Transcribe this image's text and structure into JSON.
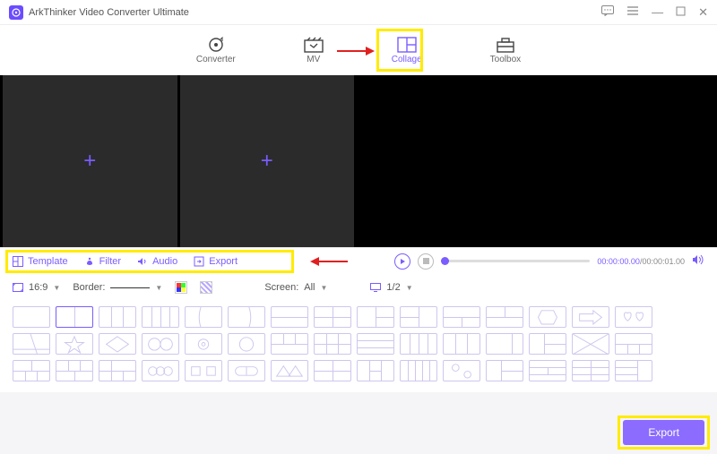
{
  "app": {
    "title": "ArkThinker Video Converter Ultimate"
  },
  "nav": {
    "converter": "Converter",
    "mv": "MV",
    "collage": "Collage",
    "toolbox": "Toolbox"
  },
  "tabs": {
    "template": "Template",
    "filter": "Filter",
    "audio": "Audio",
    "export": "Export"
  },
  "playback": {
    "current": "00:00:00.00",
    "duration": "00:00:01.00"
  },
  "options": {
    "aspect": "16:9",
    "border_label": "Border:",
    "screen_label": "Screen:",
    "screen_value": "All",
    "page": "1/2"
  },
  "footer": {
    "export_label": "Export"
  },
  "colors": {
    "accent": "#7b5cff",
    "highlight": "#ffeb00"
  }
}
